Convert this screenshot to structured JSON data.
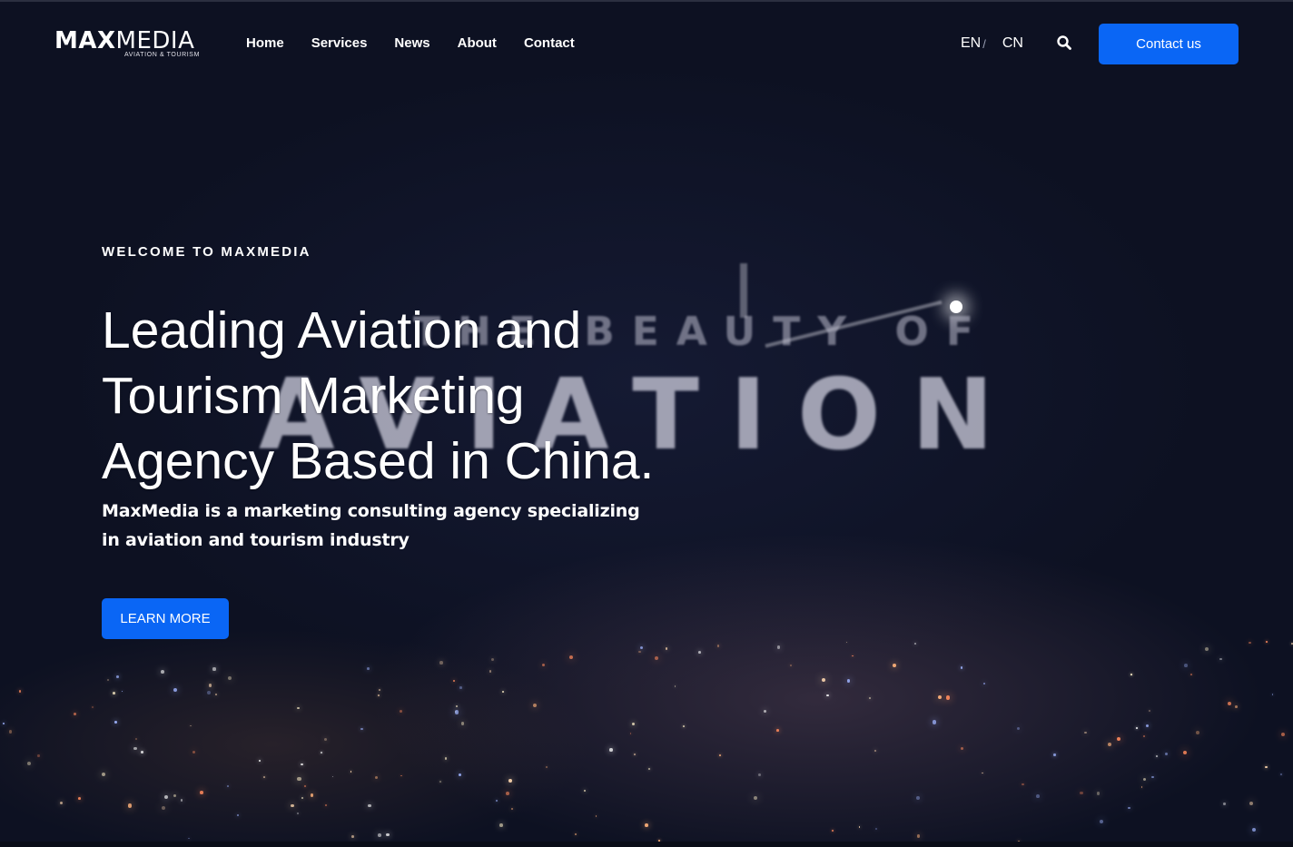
{
  "brand": {
    "logo_bold": "MAX",
    "logo_light": "MEDIA",
    "logo_tagline": "AVIATION & TOURISM"
  },
  "nav": {
    "items": [
      "Home",
      "Services",
      "News",
      "About",
      "Contact"
    ]
  },
  "language": {
    "options": [
      "EN",
      "CN"
    ],
    "separator": "/"
  },
  "header": {
    "search_icon": "search-icon",
    "contact_button": "Contact us"
  },
  "hero": {
    "eyebrow": "WELCOME TO MAXMEDIA",
    "headline": "Leading Aviation and Tourism Marketing Agency Based in China.",
    "description": "MaxMedia is a marketing consulting agency specializing in aviation and tourism industry",
    "cta_button": "LEARN MORE",
    "background_text_line1": "THE BEAUTY OF",
    "background_text_line2": "AVIATION"
  },
  "colors": {
    "accent": "#0a66f5",
    "background": "#0e1224",
    "text": "#ffffff"
  }
}
